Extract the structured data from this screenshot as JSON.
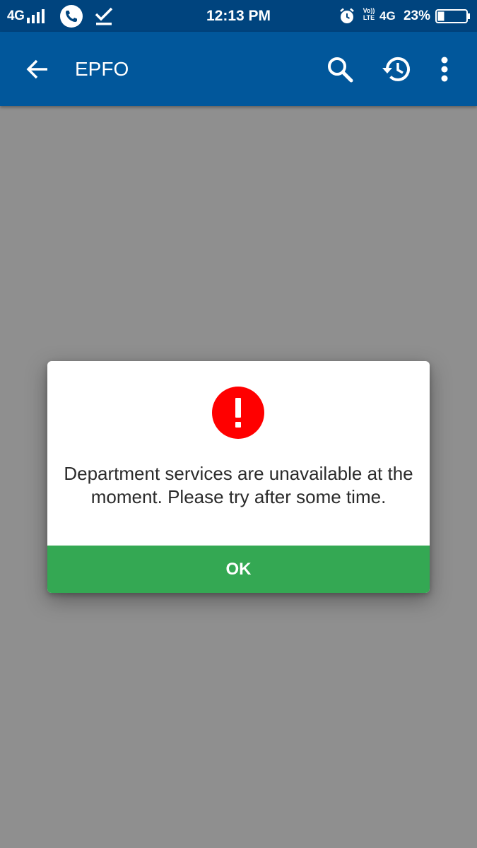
{
  "status_bar": {
    "network_left": "4G",
    "time": "12:13 PM",
    "volte_top": "Vo))",
    "volte_bottom": "LTE",
    "network_right": "4G",
    "battery_percent": "23%",
    "battery_level": 0.23
  },
  "app_bar": {
    "title": "EPFO",
    "background": "#01579b"
  },
  "dialog": {
    "icon": "error-exclamation-icon",
    "icon_color": "#ff0000",
    "message": "Department services are unavailable at the moment. Please try after some time.",
    "ok_label": "OK",
    "ok_color": "#34a853"
  }
}
